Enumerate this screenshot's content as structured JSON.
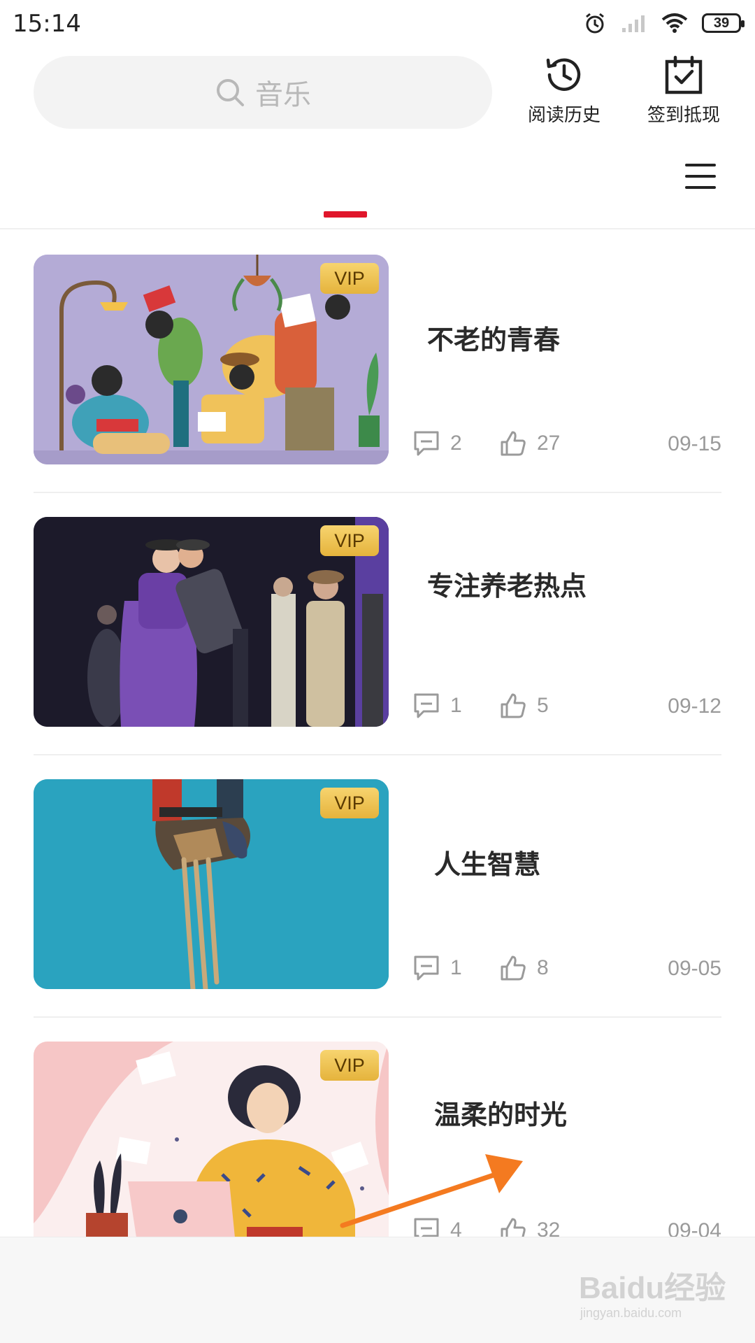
{
  "status_bar": {
    "time": "15:14",
    "battery": "39",
    "icons": [
      "alarm-icon",
      "signal-icon",
      "wifi-icon",
      "battery-icon"
    ]
  },
  "search": {
    "placeholder": "音乐"
  },
  "header_actions": [
    {
      "label": "阅读历史",
      "icon": "history-clock-icon"
    },
    {
      "label": "签到抵现",
      "icon": "calendar-check-icon"
    }
  ],
  "colors": {
    "accent": "#e0162b",
    "vip_gold": "#e5b33c",
    "annotation_arrow": "#f47a20"
  },
  "articles": [
    {
      "title": "不老的青春",
      "badge": "VIP",
      "comments": "2",
      "likes": "27",
      "date": "09-15"
    },
    {
      "title": "专注养老热点",
      "badge": "VIP",
      "comments": "1",
      "likes": "5",
      "date": "09-12"
    },
    {
      "title": "人生智慧",
      "badge": "VIP",
      "comments": "1",
      "likes": "8",
      "date": "09-05"
    },
    {
      "title": "温柔的时光",
      "badge": "VIP",
      "comments": "4",
      "likes": "32",
      "date": "09-04"
    }
  ],
  "watermark": {
    "main": "Baidu经验",
    "sub": "jingyan.baidu.com"
  }
}
